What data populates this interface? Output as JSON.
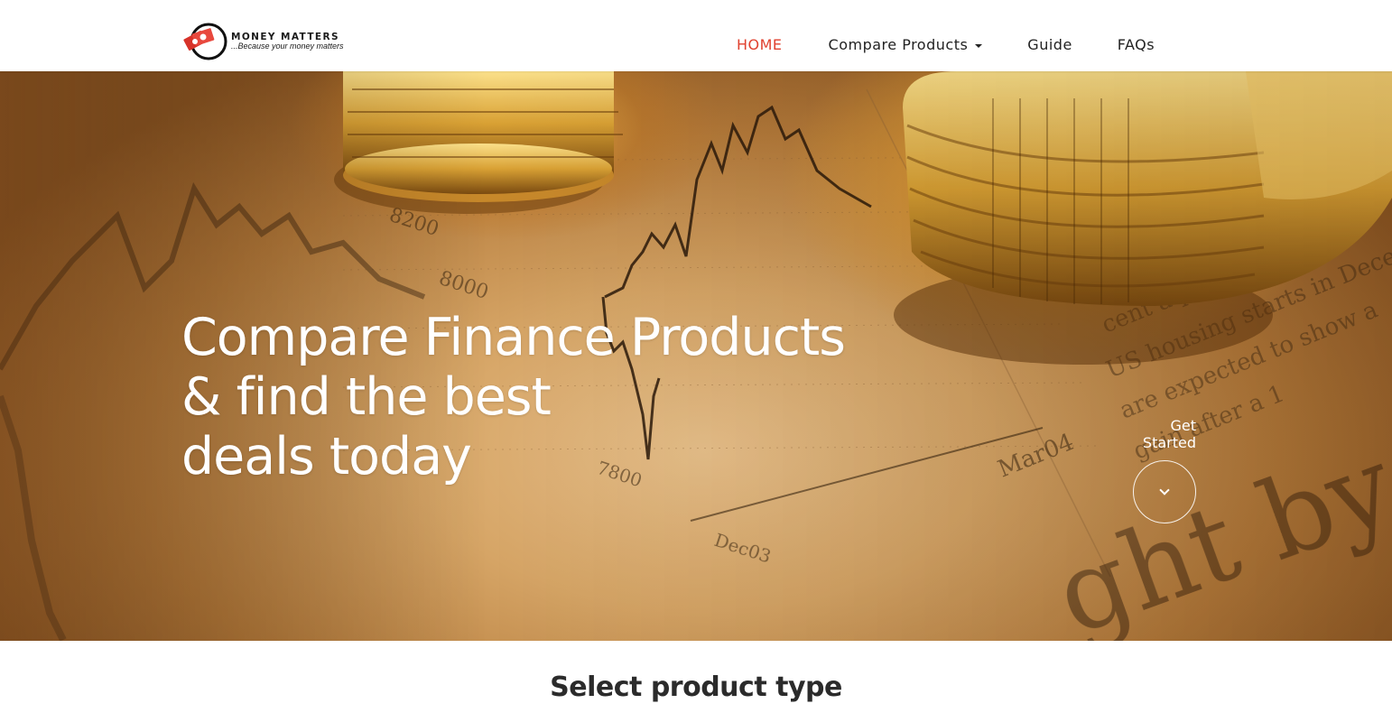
{
  "brand": {
    "name": "MONEY MATTERS",
    "tagline": "...Because your money matters",
    "logo_icon": "money-notes-icon",
    "accent_color": "#e0412f"
  },
  "nav": {
    "home": "HOME",
    "compare_products": "Compare Products",
    "guide": "Guide",
    "faqs": "FAQs",
    "active": "HOME"
  },
  "hero": {
    "title_line1": "Compare Finance Products",
    "title_line2": "& find the best",
    "title_line3": "deals today",
    "cta_line1": "Get",
    "cta_line2": "Started",
    "cta_icon": "chevron-down-icon",
    "background": "coins-and-stock-chart-photo"
  },
  "section": {
    "title": "Select product type"
  }
}
